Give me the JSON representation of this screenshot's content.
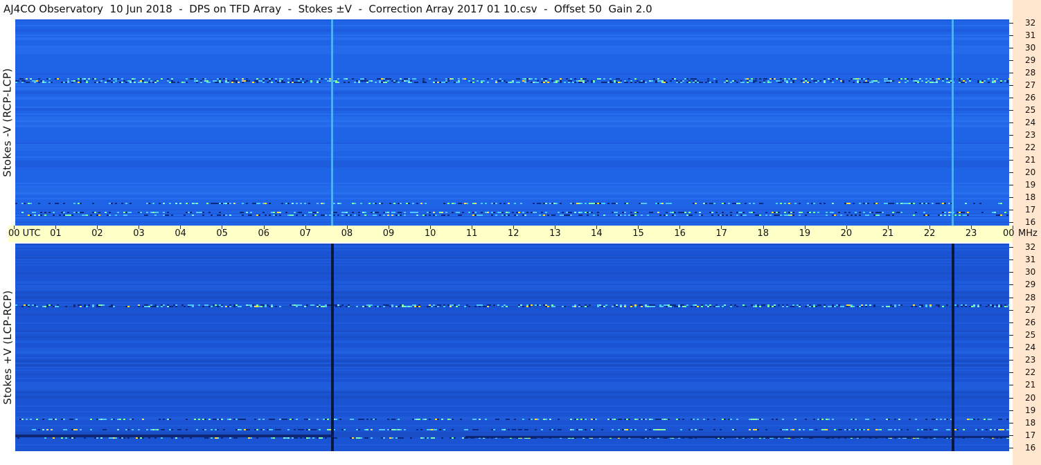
{
  "title": "AJ4CO Observatory  10 Jun 2018  -  DPS on TFD Array  -  Stokes ±V  -  Correction Array 2017 01 10.csv  -  Offset 50  Gain 2.0",
  "panels": {
    "top_label": "Stokes -V (RCP-LCP)",
    "bottom_label": "Stokes +V (LCP-RCP)"
  },
  "frequency_axis": {
    "unit": "MHz",
    "labels": [
      "32",
      "31",
      "30",
      "29",
      "28",
      "27",
      "26",
      "25",
      "24",
      "23",
      "22",
      "21",
      "20",
      "19",
      "18",
      "17",
      "16"
    ]
  },
  "time_axis": {
    "labels": [
      "00  UTC",
      "01",
      "02",
      "03",
      "04",
      "05",
      "06",
      "07",
      "08",
      "09",
      "10",
      "11",
      "12",
      "13",
      "14",
      "15",
      "16",
      "17",
      "18",
      "19",
      "20",
      "21",
      "22",
      "23",
      "00"
    ]
  },
  "colors": {
    "background_blue": "#1f63e6",
    "dark_blue": "#1a4fc4",
    "time_axis_bg": "#ffffc8",
    "freq_axis_bg": "#ffe6cf"
  }
}
